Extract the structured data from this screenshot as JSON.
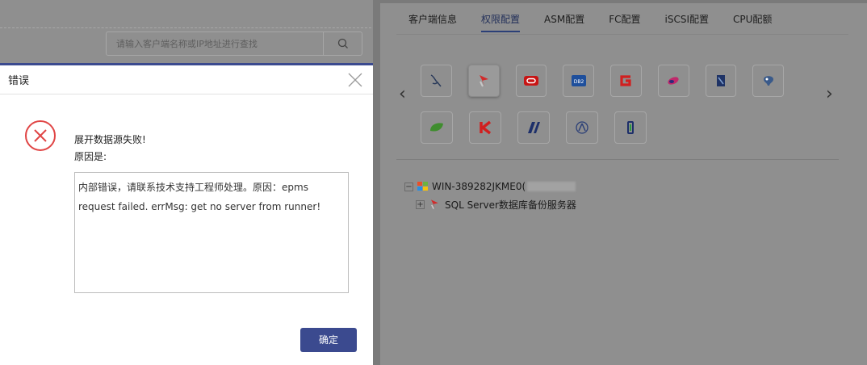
{
  "search": {
    "placeholder": "请输入客户端名称或IP地址进行查找"
  },
  "tabs": [
    {
      "label": "客户端信息"
    },
    {
      "label": "权限配置"
    },
    {
      "label": "ASM配置"
    },
    {
      "label": "FC配置"
    },
    {
      "label": "iSCSI配置"
    },
    {
      "label": "CPU配额"
    }
  ],
  "tree": {
    "host": "WIN-389282JKME0(",
    "child": "SQL Server数据库备份服务器"
  },
  "dialog": {
    "title": "错误",
    "message": "展开数据源失败!",
    "reason_label": "原因是:",
    "detail": "内部错误，请联系技术支持工程师处理。原因：epms request failed. errMsg: get no server from runner!",
    "ok_label": "确定"
  },
  "colors": {
    "accent": "#3b4a8f",
    "error": "#e04545",
    "overlay": "#8f8f8f"
  },
  "icons": {
    "db_tiles": [
      "mysql-icon",
      "sqlserver-icon",
      "oracle-icon",
      "db2-icon",
      "gbase-icon",
      "sybase-icon",
      "dameng-icon",
      "postgresql-icon",
      "mongodb-icon",
      "kingbase-icon",
      "informix-icon",
      "shentong-icon",
      "oceanbase-icon"
    ]
  }
}
